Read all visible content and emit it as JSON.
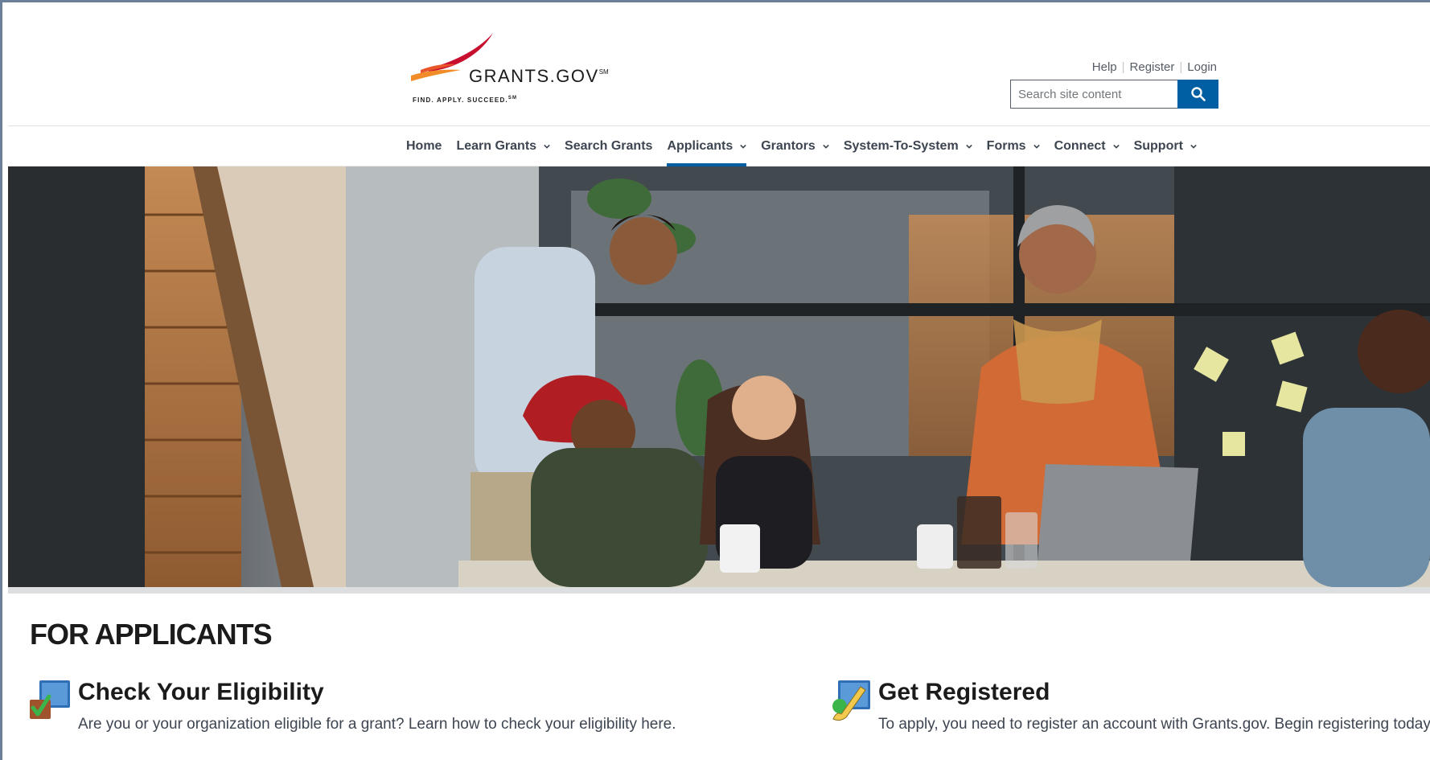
{
  "logo": {
    "wordmark": "GRANTS.GOV",
    "mark": "SM",
    "tagline": "FIND. APPLY. SUCCEED.",
    "tagline_mark": "SM"
  },
  "utility_nav": {
    "help": "Help",
    "register": "Register",
    "login": "Login"
  },
  "search": {
    "placeholder": "Search site content"
  },
  "main_nav": {
    "items": [
      {
        "label": "Home",
        "dropdown": false
      },
      {
        "label": "Learn Grants",
        "dropdown": true
      },
      {
        "label": "Search Grants",
        "dropdown": false
      },
      {
        "label": "Applicants",
        "dropdown": true,
        "active": true
      },
      {
        "label": "Grantors",
        "dropdown": true
      },
      {
        "label": "System-To-System",
        "dropdown": true
      },
      {
        "label": "Forms",
        "dropdown": true
      },
      {
        "label": "Connect",
        "dropdown": true
      },
      {
        "label": "Support",
        "dropdown": true
      }
    ]
  },
  "page": {
    "title": "FOR APPLICANTS"
  },
  "cards": [
    {
      "title": "Check Your Eligibility",
      "description": "Are you or your organization eligible for a grant? Learn how to check your eligibility here."
    },
    {
      "title": "Get Registered",
      "description": "To apply, you need to register an account with Grants.gov. Begin registering today."
    }
  ],
  "colors": {
    "primary_blue": "#005ea2",
    "nav_text": "#3d4551",
    "logo_red": "#c8102e",
    "logo_orange": "#f28c28"
  },
  "icons": [
    "search-icon",
    "chevron-down-icon",
    "checklist-icon",
    "register-pen-icon"
  ]
}
